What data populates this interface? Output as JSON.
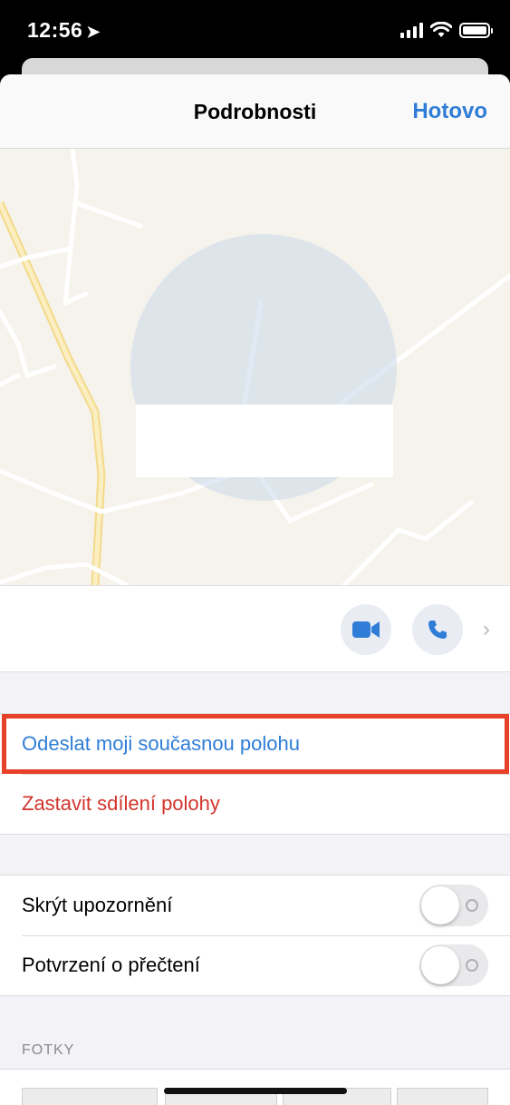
{
  "status_bar": {
    "time": "12:56",
    "location_icon": "location-arrow-icon",
    "signal_icon": "cellular-signal-icon",
    "wifi_icon": "wifi-icon",
    "battery_icon": "battery-icon"
  },
  "nav": {
    "title": "Podrobnosti",
    "done_label": "Hotovo"
  },
  "map": {
    "description_icon": "map-view"
  },
  "contact": {
    "video_icon": "video-camera-icon",
    "phone_icon": "phone-icon",
    "chevron_icon": "chevron-right-icon"
  },
  "location_actions": {
    "send_current": "Odeslat moji současnou polohu",
    "stop_sharing": "Zastavit sdílení polohy"
  },
  "settings": [
    {
      "label": "Skrýt upozornění",
      "on": false
    },
    {
      "label": "Potvrzení o přečtení",
      "on": false
    }
  ],
  "photos": {
    "header": "FOTKY"
  },
  "colors": {
    "accent": "#2f7dd6",
    "destructive": "#d2342c",
    "highlight": "#e8412a"
  }
}
